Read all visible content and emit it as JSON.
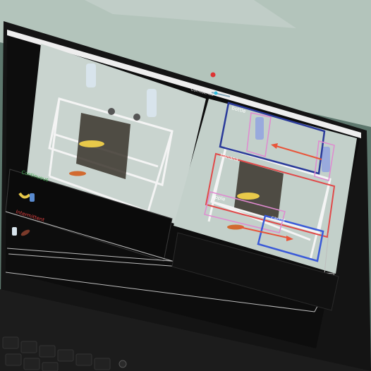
{
  "screen": {
    "slider_label": "Confidence",
    "left_panel": {
      "section_top_label": "Continuous",
      "section_bottom_label": "Intermittent"
    },
    "right_panel": {
      "detections": [
        {
          "label": "bottle",
          "color": "#2a3a9a"
        },
        {
          "label": "banana",
          "color": "#e04a4a"
        },
        {
          "label": "apple",
          "color": "#e08ad0"
        },
        {
          "label": "carrot",
          "color": "#3a5ad8"
        }
      ]
    }
  },
  "colors": {
    "bezel": "#141414",
    "ui_bg": "#0d0d0d",
    "accent_green": "#3aa04a",
    "accent_red": "#e04040",
    "arrow": "#e8553a"
  },
  "icons": [
    "banana-icon",
    "bottle-icon",
    "sausage-icon"
  ]
}
